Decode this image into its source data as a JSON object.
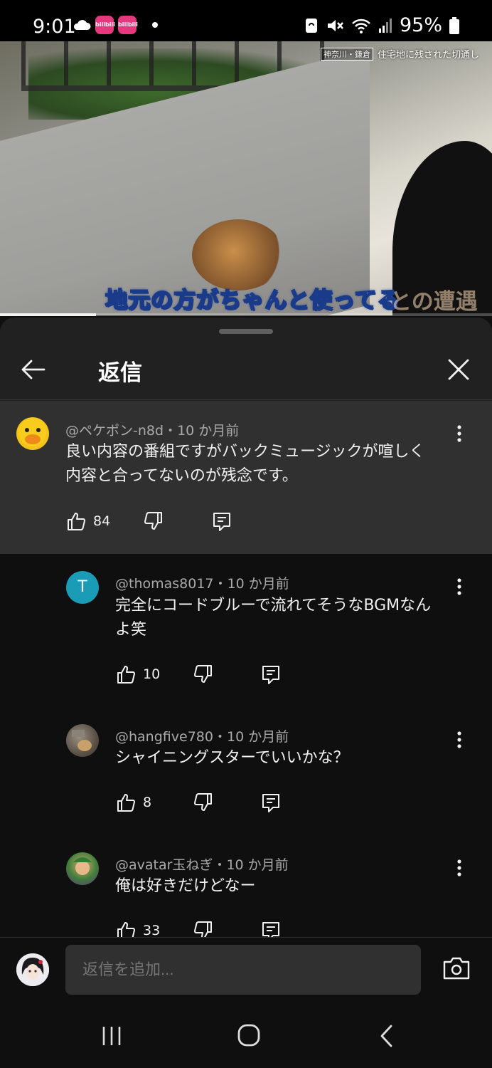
{
  "status_bar": {
    "time": "9:01",
    "battery": "95%",
    "icons": [
      "cloud-icon",
      "app-badge-icon",
      "app-badge-icon",
      "notification-dot-icon",
      "sync-icon",
      "mute-icon",
      "wifi-icon",
      "signal-icon",
      "battery-icon"
    ]
  },
  "video": {
    "caption": "地元の方がちゃんと使ってる",
    "caption_partial": "との遭遇",
    "tag_location": "神奈川・鎌倉",
    "tag_text": "住宅地に残された切通し",
    "progress_fraction": 0.195
  },
  "sheet": {
    "title": "返信"
  },
  "parent_comment": {
    "author": "@ペケポン-n8d",
    "time": "10 か月前",
    "text_line1": "良い内容の番組ですがバックミュージックが喧しく",
    "text_line2": "内容と合ってないのが残念です。",
    "likes": "84"
  },
  "replies": [
    {
      "author": "@thomas8017",
      "time": "10 か月前",
      "text_line1": "完全にコードブルーで流れてそうなBGMなん",
      "text_line2": "よ笑",
      "likes": "10",
      "avatar_letter": "T",
      "avatar_color": "#1a9bb6"
    },
    {
      "author": "@hangfive780",
      "time": "10 か月前",
      "text_line1": "シャイニングスターでいいかな？",
      "text_line2": "",
      "likes": "8"
    },
    {
      "author": "@avatar玉ねぎ",
      "time": "10 か月前",
      "text_line1": "俺は好きだけどなー",
      "text_line2": "",
      "likes": "33"
    }
  ],
  "meta_separator": "・",
  "input": {
    "placeholder": "返信を追加..."
  },
  "colors": {
    "background": "#0f0f0f",
    "sheet": "#212121",
    "highlight": "#303030",
    "secondary_text": "#aaaaaa"
  }
}
